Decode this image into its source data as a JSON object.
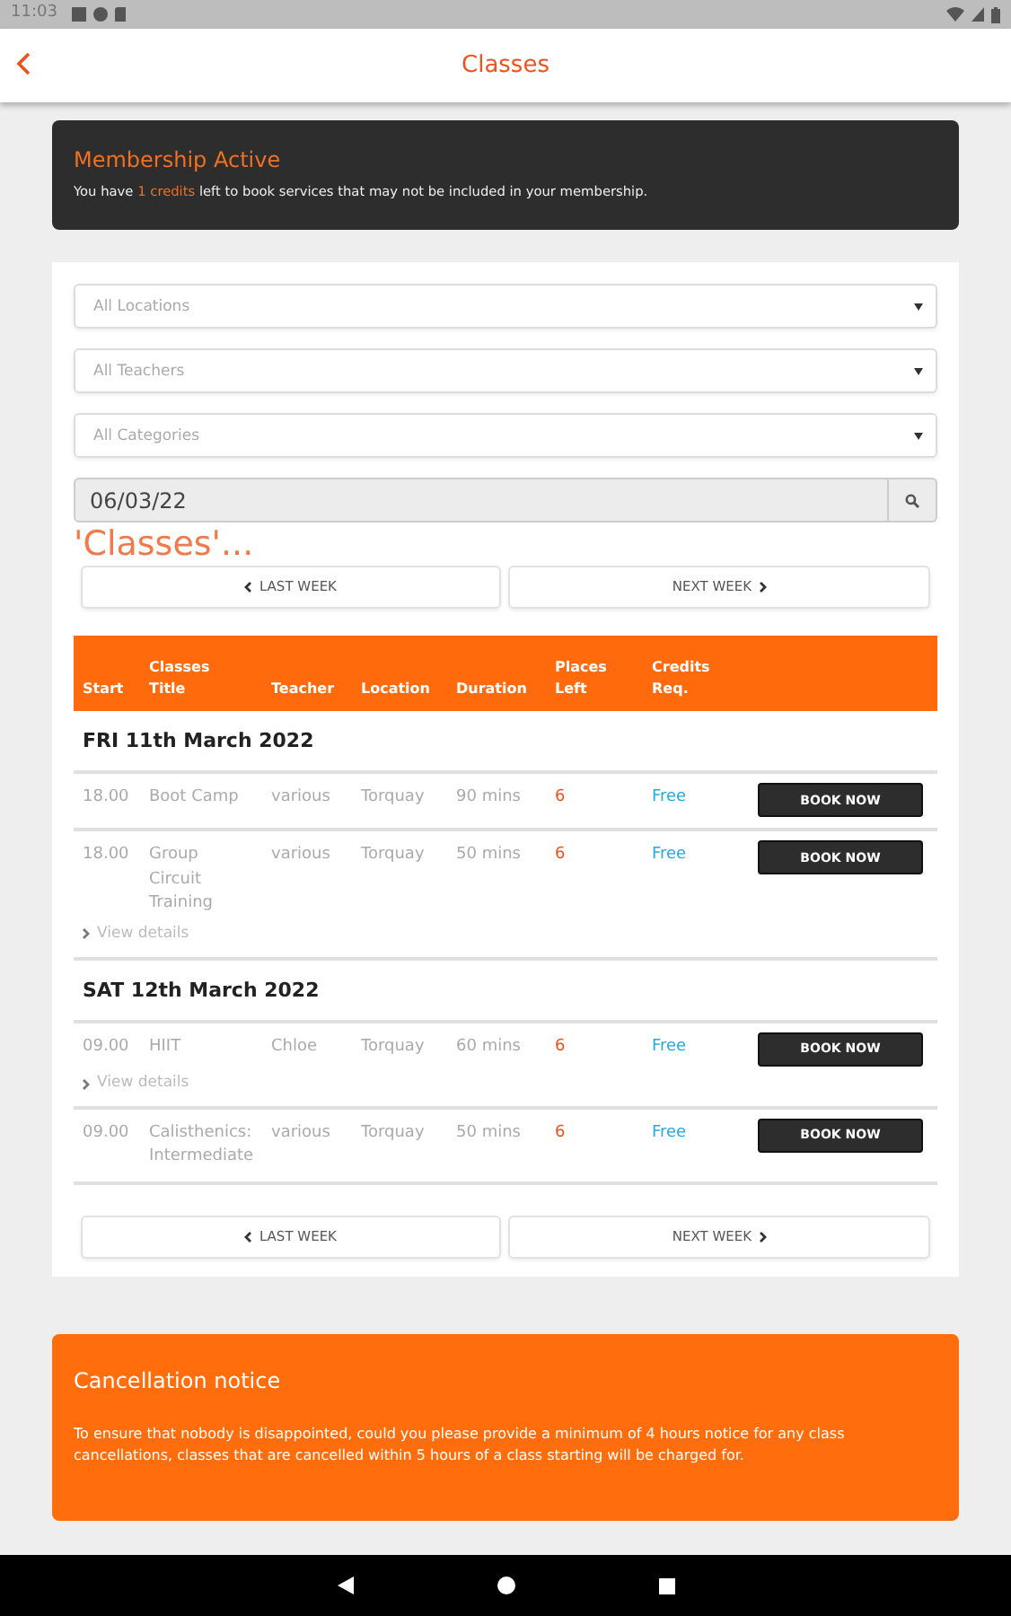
{
  "status_bar": {
    "time": "11:03"
  },
  "header": {
    "title": "Classes"
  },
  "membership": {
    "title": "Membership Active",
    "text_before": "You have ",
    "highlight": "1 credits",
    "text_after": " left to book services that may not be included in your membership."
  },
  "filters": [
    {
      "placeholder": "All Locations"
    },
    {
      "placeholder": "All Teachers"
    },
    {
      "placeholder": "All Categories"
    }
  ],
  "date_field": {
    "value": "06/03/22"
  },
  "heading": "'Classes'...",
  "week_nav_top": [
    "LAST WEEK",
    "NEXT WEEK"
  ],
  "table": {
    "columns": [
      "Start",
      "Classes Title",
      "Teacher",
      "Location",
      "Duration",
      "Places Left",
      "Credits Req."
    ],
    "days": [
      {
        "date": "FRI 11th March 2022",
        "classes": [
          {
            "start": "18.00",
            "title": "Boot Camp",
            "teacher": "various",
            "location": "Torquay",
            "duration": "90 mins",
            "places": "6",
            "credits": "Free",
            "button": "BOOK NOW"
          },
          {
            "start": "18.00",
            "title": "Group Circuit Training",
            "teacher": "various",
            "location": "Torquay",
            "duration": "50 mins",
            "places": "6",
            "credits": "Free",
            "button": "BOOK NOW",
            "details": "View details"
          }
        ]
      },
      {
        "date": "SAT 12th March 2022",
        "classes": [
          {
            "start": "09.00",
            "title": "HIIT",
            "teacher": "Chloe",
            "location": "Torquay",
            "duration": "60 mins",
            "places": "6",
            "credits": "Free",
            "button": "BOOK NOW",
            "details": "View details"
          },
          {
            "start": "09.00",
            "title": "Calisthenics: Intermediate",
            "teacher": "various",
            "location": "Torquay",
            "duration": "50 mins",
            "places": "6",
            "credits": "Free",
            "button": "BOOK NOW"
          }
        ]
      }
    ]
  },
  "week_nav_bottom": [
    "LAST WEEK",
    "NEXT WEEK"
  ],
  "notice": {
    "title": "Cancellation notice",
    "text": "To ensure that nobody is disappointed, could you please provide a minimum of 4 hours notice for any class cancellations, classes that are cancelled within 5 hours of a class starting will be charged for."
  }
}
